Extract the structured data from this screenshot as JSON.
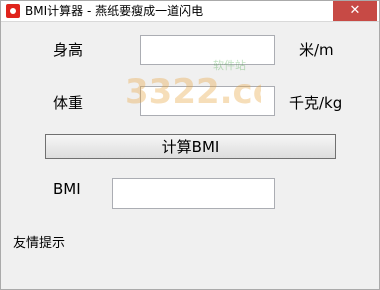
{
  "window": {
    "title": "BMI计算器 - 燕纸要瘦成一道闪电",
    "close_symbol": "✕"
  },
  "form": {
    "height_label": "身高",
    "height_value": "",
    "height_unit": "米/m",
    "weight_label": "体重",
    "weight_value": "",
    "weight_unit": "千克/kg",
    "calculate_label": "计算BMI",
    "bmi_label": "BMI",
    "bmi_value": "",
    "tip_label": "友情提示"
  },
  "watermark": {
    "text": "3322.cc",
    "subtext": "软件站"
  }
}
